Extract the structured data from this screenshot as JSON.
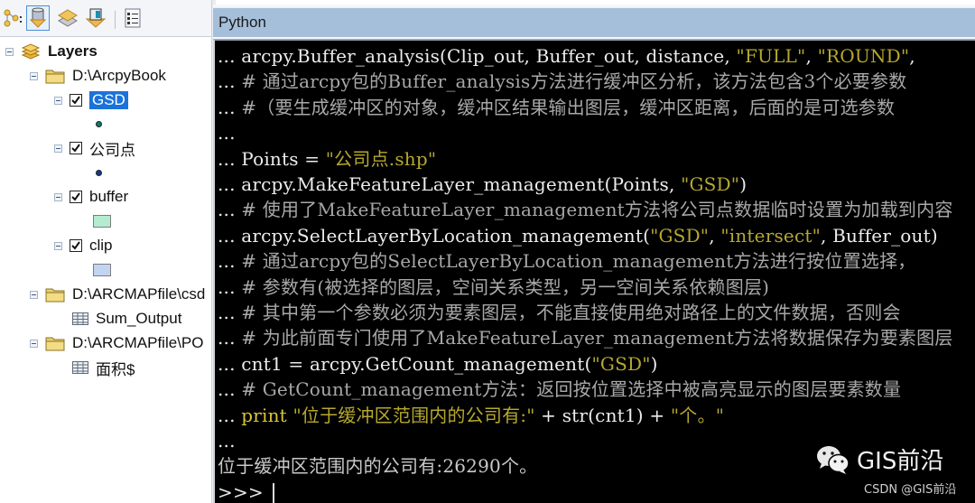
{
  "toc": {
    "toolbar": [
      {
        "name": "list-by-drawing-order",
        "icon": "layers-tree-icon"
      },
      {
        "name": "list-by-source",
        "icon": "database-icon",
        "active": true
      },
      {
        "name": "list-by-visibility",
        "icon": "layer-stack-icon"
      },
      {
        "name": "list-by-selection",
        "icon": "selection-layer-icon"
      },
      {
        "name": "options",
        "icon": "options-list-icon"
      }
    ],
    "tree": {
      "root_label": "Layers",
      "sources": [
        {
          "label": "D:\\ArcpyBook",
          "layers": [
            {
              "label": "GSD",
              "checked": true,
              "selected": true,
              "symbol": "point",
              "symbol_color": "#0a7a6e"
            },
            {
              "label": "公司点",
              "checked": true,
              "selected": false,
              "symbol": "point",
              "symbol_color": "#0d3c8f"
            },
            {
              "label": "buffer",
              "checked": true,
              "selected": false,
              "symbol": "polygon",
              "symbol_color": "#b5ebcf"
            },
            {
              "label": "clip",
              "checked": true,
              "selected": false,
              "symbol": "polygon",
              "symbol_color": "#c2d4f2"
            }
          ]
        },
        {
          "label": "D:\\ARCMAPfile\\csd",
          "tables": [
            {
              "label": "Sum_Output"
            }
          ]
        },
        {
          "label": "D:\\ARCMAPfile\\PO",
          "tables": [
            {
              "label": "面积$"
            }
          ]
        }
      ]
    }
  },
  "python_window": {
    "title": "Python",
    "lines": [
      {
        "prompt": "... ",
        "segments": [
          {
            "t": "code",
            "v": "arcpy.Buffer_analysis(Clip_out, Buffer_out, distance, "
          },
          {
            "t": "string",
            "v": "\"FULL\""
          },
          {
            "t": "code",
            "v": ", "
          },
          {
            "t": "string",
            "v": "\"ROUND\""
          },
          {
            "t": "code",
            "v": ","
          }
        ]
      },
      {
        "prompt": "... ",
        "segments": [
          {
            "t": "comment",
            "v": "# 通过arcpy包的Buffer_analysis方法进行缓冲区分析，该方法包含3个必要参数"
          }
        ]
      },
      {
        "prompt": "... ",
        "segments": [
          {
            "t": "comment",
            "v": "#（要生成缓冲区的对象，缓冲区结果输出图层，缓冲区距离，后面的是可选参数"
          }
        ]
      },
      {
        "prompt": "...",
        "segments": []
      },
      {
        "prompt": "... ",
        "segments": [
          {
            "t": "code",
            "v": "Points = "
          },
          {
            "t": "string",
            "v": "\"公司点.shp\""
          }
        ]
      },
      {
        "prompt": "... ",
        "segments": [
          {
            "t": "code",
            "v": "arcpy.MakeFeatureLayer_management(Points, "
          },
          {
            "t": "string",
            "v": "\"GSD\""
          },
          {
            "t": "code",
            "v": ")"
          }
        ]
      },
      {
        "prompt": "... ",
        "segments": [
          {
            "t": "comment",
            "v": "# 使用了MakeFeatureLayer_management方法将公司点数据临时设置为加载到内容"
          }
        ]
      },
      {
        "prompt": "... ",
        "segments": [
          {
            "t": "code",
            "v": "arcpy.SelectLayerByLocation_management("
          },
          {
            "t": "string",
            "v": "\"GSD\""
          },
          {
            "t": "code",
            "v": ", "
          },
          {
            "t": "string",
            "v": "\"intersect\""
          },
          {
            "t": "code",
            "v": ", Buffer_out)"
          }
        ]
      },
      {
        "prompt": "... ",
        "segments": [
          {
            "t": "comment",
            "v": "# 通过arcpy包的SelectLayerByLocation_management方法进行按位置选择，"
          }
        ]
      },
      {
        "prompt": "... ",
        "segments": [
          {
            "t": "comment",
            "v": "# 参数有(被选择的图层，空间关系类型，另一空间关系依赖图层)"
          }
        ]
      },
      {
        "prompt": "... ",
        "segments": [
          {
            "t": "comment",
            "v": "# 其中第一个参数必须为要素图层，不能直接使用绝对路径上的文件数据，否则会"
          }
        ]
      },
      {
        "prompt": "... ",
        "segments": [
          {
            "t": "comment",
            "v": "# 为此前面专门使用了MakeFeatureLayer_management方法将数据保存为要素图层"
          }
        ]
      },
      {
        "prompt": "... ",
        "segments": [
          {
            "t": "code",
            "v": "cnt1 = arcpy.GetCount_management("
          },
          {
            "t": "string",
            "v": "\"GSD\""
          },
          {
            "t": "code",
            "v": ")"
          }
        ]
      },
      {
        "prompt": "... ",
        "segments": [
          {
            "t": "comment",
            "v": "# GetCount_management方法：返回按位置选择中被高亮显示的图层要素数量"
          }
        ]
      },
      {
        "prompt": "... ",
        "segments": [
          {
            "t": "keyword",
            "v": "print "
          },
          {
            "t": "string",
            "v": "\"位于缓冲区范围内的公司有:\""
          },
          {
            "t": "code",
            "v": " + str(cnt1) + "
          },
          {
            "t": "string",
            "v": "\"个。\""
          }
        ]
      },
      {
        "prompt": "...",
        "segments": []
      },
      {
        "prompt": "",
        "segments": [
          {
            "t": "output",
            "v": "位于缓冲区范围内的公司有:26290个。"
          }
        ]
      },
      {
        "prompt": ">>> ",
        "segments": [],
        "cursor": true
      }
    ]
  },
  "watermark": {
    "wechat": "GIS前沿",
    "csdn": "CSDN @GIS前沿"
  }
}
